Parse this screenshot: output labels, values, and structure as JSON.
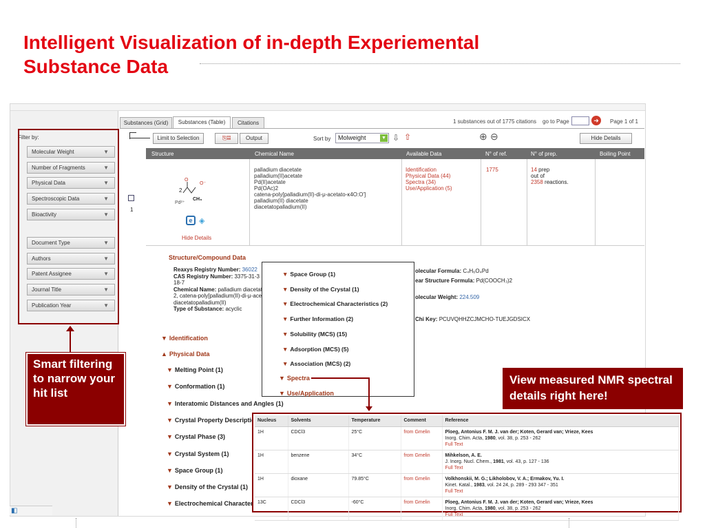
{
  "slide": {
    "title_line1": "Intelligent Visualization of in-depth Experiemental",
    "title_line2": "Substance Data"
  },
  "tabs": [
    {
      "label": "Substances (Grid)"
    },
    {
      "label": "Substances (Table)"
    },
    {
      "label": "Citations"
    }
  ],
  "pager": {
    "hits": "1 substances out of 1775 citations",
    "goto_label": "go to Page",
    "page_of": "Page 1 of 1"
  },
  "filters": {
    "label": "Filter by:",
    "group1": [
      "Molecular Weight",
      "Number of Fragments",
      "Physical Data",
      "Spectroscopic Data",
      "Bioactivity"
    ],
    "group2": [
      "Document Type",
      "Authors",
      "Patent Assignee",
      "Journal Title",
      "Publication Year"
    ]
  },
  "toolbar": {
    "limit_label": "Limit to Selection",
    "output_label": "Output",
    "sort_label": "Sort by",
    "sort_value": "Molweight",
    "hide_details_label": "Hide Details"
  },
  "columns": [
    "Structure",
    "Chemical Name",
    "Available Data",
    "N° of ref.",
    "N° of prep.",
    "Boiling Point"
  ],
  "row": {
    "number": "1",
    "names": [
      "palladium diacetate",
      "palladium(II)acetate",
      "Pd(II)acetate",
      "Pd(OAc)2",
      "catena-poly[palladium(II)-di-μ-acetato-κ4O:O']",
      "palladium(II) diacetate",
      "diacetatopalladium(II)"
    ],
    "available": [
      "Identification",
      "Physical Data (44)",
      "Spectra (34)",
      "Use/Application (5)"
    ],
    "refs": "1775",
    "prep_count": "14",
    "prep_text": "prep",
    "out_of": "out of",
    "reactions_count": "2358",
    "reactions_text": "reactions.",
    "hide_details": "Hide Details",
    "struct_two": "2",
    "struct_o1": "O",
    "struct_o2": "O⁻",
    "struct_pd": "Pd²⁺",
    "struct_ch3": "CH₃"
  },
  "details": {
    "section_title": "Structure/Compound Data",
    "rrn_label": "Reaxys Registry Number:",
    "rrn_value": "36022",
    "cas_label": "CAS Registry Number:",
    "cas_value": "3375-31-3",
    "cas_value2": "18-7",
    "chemname_label": "Chemical Name:",
    "chemname_value": "palladium diacetat",
    "chemname_value2": "2, catena-poly[palladium(II)-di-μ-ace",
    "chemname_value3": "diacetatopalladium(II)",
    "type_label": "Type of Substance:",
    "type_value": "acyclic",
    "mf_label": "olecular Formula:",
    "mf_value": "C₄H₆O₄Pd",
    "lsf_label": "ear Structure Formula:",
    "lsf_value": "Pd(COOCH₃)2",
    "mw_label": "olecular Weight:",
    "mw_value": "224.509",
    "inchi_label": "Chi Key:",
    "inchi_value": "PCUVQHHZCJMCHO-TUEJGDSICX",
    "identification": "Identification",
    "physical_data": "Physical Data",
    "physical_items": [
      "Melting Point (1)",
      "Conformation (1)",
      "Interatomic Distances and Angles (1)",
      "Crystal Property Descriptio",
      "Crystal Phase (3)",
      "Crystal System (1)",
      "Space Group (1)",
      "Density of the Crystal (1)",
      "Electrochemical Characteris"
    ]
  },
  "popup": {
    "items": [
      "Space Group (1)",
      "Density of the Crystal (1)",
      "Electrochemical Characteristics (2)",
      "Further Information (2)",
      "Solubility (MCS) (15)",
      "Adsorption (MCS) (5)",
      "Association (MCS) (2)"
    ],
    "spectra": "Spectra",
    "use_application": "Use/Application"
  },
  "nmr": {
    "headers": [
      "Nucleus",
      "Solvents",
      "Temperature",
      "Comment",
      "Reference"
    ],
    "rows": [
      {
        "nucleus": "1H",
        "solvent": "CDCl3",
        "temp": "25°C",
        "comment": "from Gmelin",
        "authors": "Ploeg, Antonius F. M. J. van der; Koten, Gerard van; Vrieze, Kees",
        "journal": "Inorg. Chim. Acta,",
        "year": "1980",
        "pages": ", vol. 38, p. 253 - 262",
        "fulltext": "Full Text"
      },
      {
        "nucleus": "1H",
        "solvent": "benzene",
        "temp": "34°C",
        "comment": "from Gmelin",
        "authors": "Mihkelson, A. E.",
        "journal": "J. Inorg. Nucl. Chem.,",
        "year": "1981",
        "pages": ", vol. 43, p. 127 - 136",
        "fulltext": "Full Text"
      },
      {
        "nucleus": "1H",
        "solvent": "dioxane",
        "temp": "79.85°C",
        "comment": "from Gmelin",
        "authors": "Volkhonskii, M. G.; Likholobov, V. A.; Ermakov, Yu. I.",
        "journal": "Kinet. Katal.,",
        "year": "1983",
        "pages": ", vol. 24 24, p. 289 - 293 347 - 351",
        "fulltext": "Full Text"
      },
      {
        "nucleus": "13C",
        "solvent": "CDCl3",
        "temp": "-60°C",
        "comment": "from Gmelin",
        "authors": "Ploeg, Antonius F. M. J. van der; Koten, Gerard van; Vrieze, Kees",
        "journal": "Inorg. Chim. Acta,",
        "year": "1980",
        "pages": ", vol. 38, p. 253 - 262",
        "fulltext": "Full Text"
      }
    ]
  },
  "callouts": {
    "left": "Smart filtering to narrow your hit list",
    "right": "View measured NMR spectral details right here!"
  },
  "colors": {
    "title_red": "#e30613",
    "callout_red": "#8b0000",
    "link_red": "#c0392b",
    "link_blue": "#3466a8"
  },
  "icons": [
    "double-chevron-icon",
    "export-icon",
    "print-icon",
    "arrow-down-icon",
    "arrow-up-icon",
    "zoom-in-icon",
    "zoom-out-icon",
    "go-arrow-icon",
    "triangle-expand-icon",
    "ie-page-icon"
  ]
}
